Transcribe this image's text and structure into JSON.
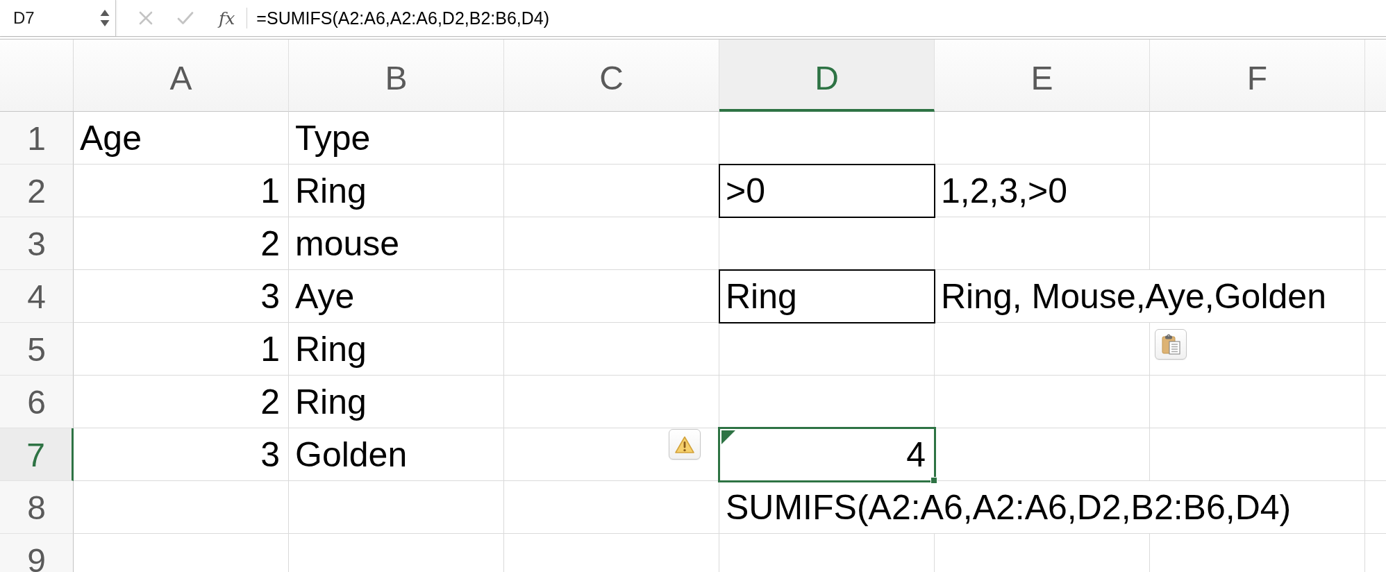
{
  "name_box": {
    "value": "D7"
  },
  "formula_bar": {
    "function_label": "fx",
    "value": "=SUMIFS(A2:A6,A2:A6,D2,B2:B6,D4)"
  },
  "columns": [
    {
      "label": "A",
      "selected": false
    },
    {
      "label": "B",
      "selected": false
    },
    {
      "label": "C",
      "selected": false
    },
    {
      "label": "D",
      "selected": true
    },
    {
      "label": "E",
      "selected": false
    },
    {
      "label": "F",
      "selected": false
    }
  ],
  "rows": [
    {
      "label": "1",
      "selected": false,
      "cells": [
        {
          "kind": "text",
          "value": "Age",
          "bordered": false,
          "flagged": false
        },
        {
          "kind": "text",
          "value": "Type",
          "bordered": false,
          "flagged": false
        },
        {
          "kind": "blank",
          "bordered": false,
          "flagged": false
        },
        {
          "kind": "blank",
          "bordered": false,
          "flagged": false
        },
        {
          "kind": "blank",
          "bordered": false,
          "flagged": false
        },
        {
          "kind": "blank",
          "bordered": false,
          "flagged": false
        }
      ]
    },
    {
      "label": "2",
      "selected": false,
      "cells": [
        {
          "kind": "number",
          "value": "1",
          "bordered": false,
          "flagged": false
        },
        {
          "kind": "text",
          "value": "Ring",
          "bordered": false,
          "flagged": false
        },
        {
          "kind": "blank",
          "bordered": false,
          "flagged": false
        },
        {
          "kind": "text",
          "value": ">0",
          "bordered": true,
          "flagged": false
        },
        {
          "kind": "text",
          "value": "1,2,3,>0",
          "bordered": false,
          "flagged": false
        },
        {
          "kind": "blank",
          "bordered": false,
          "flagged": false
        }
      ]
    },
    {
      "label": "3",
      "selected": false,
      "cells": [
        {
          "kind": "number",
          "value": "2",
          "bordered": false,
          "flagged": false
        },
        {
          "kind": "text",
          "value": "mouse",
          "bordered": false,
          "flagged": false
        },
        {
          "kind": "blank",
          "bordered": false,
          "flagged": false
        },
        {
          "kind": "blank",
          "bordered": false,
          "flagged": false
        },
        {
          "kind": "blank",
          "bordered": false,
          "flagged": false
        },
        {
          "kind": "blank",
          "bordered": false,
          "flagged": false
        }
      ]
    },
    {
      "label": "4",
      "selected": false,
      "cells": [
        {
          "kind": "number",
          "value": "3",
          "bordered": false,
          "flagged": false
        },
        {
          "kind": "text",
          "value": "Aye",
          "bordered": false,
          "flagged": false
        },
        {
          "kind": "blank",
          "bordered": false,
          "flagged": false
        },
        {
          "kind": "text",
          "value": "Ring",
          "bordered": true,
          "flagged": false
        },
        {
          "kind": "text",
          "value": "Ring, Mouse,Aye,Golden",
          "bordered": false,
          "flagged": false
        },
        {
          "kind": "blank",
          "bordered": false,
          "flagged": false
        }
      ]
    },
    {
      "label": "5",
      "selected": false,
      "cells": [
        {
          "kind": "number",
          "value": "1",
          "bordered": false,
          "flagged": false
        },
        {
          "kind": "text",
          "value": "Ring",
          "bordered": false,
          "flagged": false
        },
        {
          "kind": "blank",
          "bordered": false,
          "flagged": false
        },
        {
          "kind": "blank",
          "bordered": false,
          "flagged": false
        },
        {
          "kind": "blank",
          "bordered": false,
          "flagged": false
        },
        {
          "kind": "blank",
          "bordered": false,
          "flagged": false
        }
      ]
    },
    {
      "label": "6",
      "selected": false,
      "cells": [
        {
          "kind": "number",
          "value": "2",
          "bordered": false,
          "flagged": false
        },
        {
          "kind": "text",
          "value": "Ring",
          "bordered": false,
          "flagged": false
        },
        {
          "kind": "blank",
          "bordered": false,
          "flagged": false
        },
        {
          "kind": "blank",
          "bordered": false,
          "flagged": false
        },
        {
          "kind": "blank",
          "bordered": false,
          "flagged": false
        },
        {
          "kind": "blank",
          "bordered": false,
          "flagged": false
        }
      ]
    },
    {
      "label": "7",
      "selected": true,
      "cells": [
        {
          "kind": "number",
          "value": "3",
          "bordered": false,
          "flagged": false
        },
        {
          "kind": "text",
          "value": "Golden",
          "bordered": false,
          "flagged": false
        },
        {
          "kind": "blank",
          "bordered": false,
          "flagged": false
        },
        {
          "kind": "number",
          "value": "4",
          "bordered": false,
          "flagged": true
        },
        {
          "kind": "blank",
          "bordered": false,
          "flagged": false
        },
        {
          "kind": "blank",
          "bordered": false,
          "flagged": false
        }
      ]
    },
    {
      "label": "8",
      "selected": false,
      "cells": [
        {
          "kind": "blank",
          "bordered": false,
          "flagged": false
        },
        {
          "kind": "blank",
          "bordered": false,
          "flagged": false
        },
        {
          "kind": "blank",
          "bordered": false,
          "flagged": false
        },
        {
          "kind": "text",
          "value": "SUMIFS(A2:A6,A2:A6,D2,B2:B6,D4)",
          "bordered": false,
          "flagged": false
        },
        {
          "kind": "blank",
          "bordered": false,
          "flagged": false
        },
        {
          "kind": "blank",
          "bordered": false,
          "flagged": false
        }
      ]
    },
    {
      "label": "9",
      "selected": false,
      "cells": [
        {
          "kind": "blank",
          "bordered": false,
          "flagged": false
        },
        {
          "kind": "blank",
          "bordered": false,
          "flagged": false
        },
        {
          "kind": "blank",
          "bordered": false,
          "flagged": false
        },
        {
          "kind": "blank",
          "bordered": false,
          "flagged": false
        },
        {
          "kind": "blank",
          "bordered": false,
          "flagged": false
        },
        {
          "kind": "blank",
          "bordered": false,
          "flagged": false
        }
      ]
    }
  ]
}
